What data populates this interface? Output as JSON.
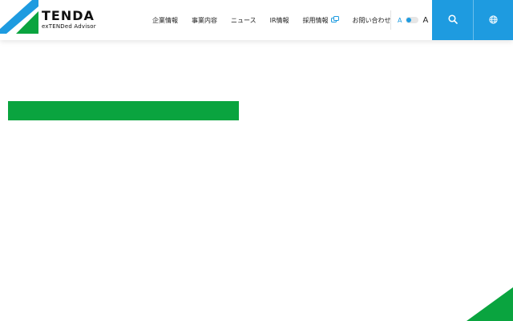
{
  "brand": {
    "name": "TENDA",
    "tagline": "exTENDed Advisor",
    "colors": {
      "blue": "#1e9be0",
      "green": "#0aa43f"
    }
  },
  "nav": {
    "items": [
      {
        "label": "企業情報"
      },
      {
        "label": "事業内容"
      },
      {
        "label": "ニュース"
      },
      {
        "label": "IR情報"
      },
      {
        "label": "採用情報",
        "icon": "external-link-icon"
      },
      {
        "label": "お問い合わせ"
      }
    ]
  },
  "font_size_toggle": {
    "small_label": "A",
    "large_label": "A"
  },
  "actions": {
    "search_icon": "search-icon",
    "language_icon": "globe-icon"
  }
}
